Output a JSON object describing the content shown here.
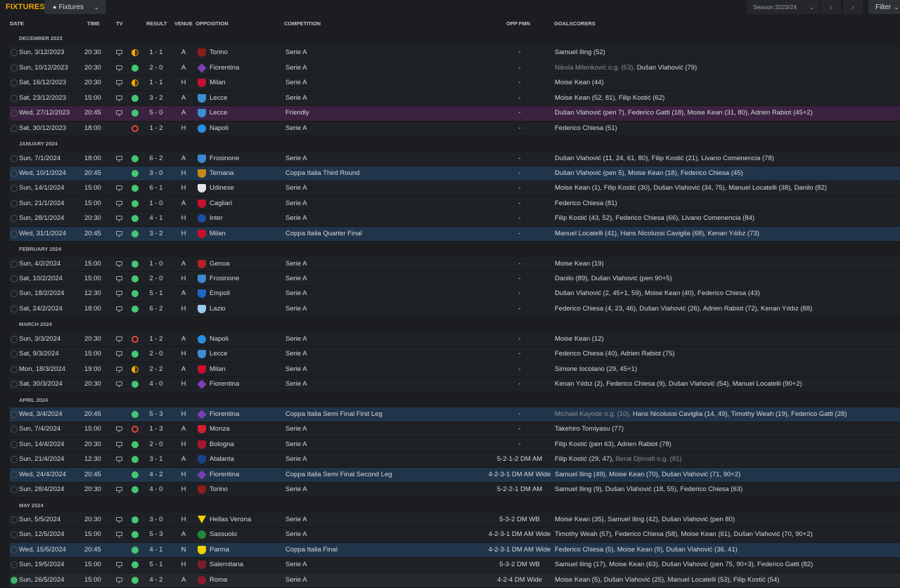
{
  "topbar": {
    "title": "FIXTURES",
    "view_label": "Fixtures",
    "season_label": "Season 2023/24",
    "filter_label": "Filter",
    "prev_icon": "chevron-left-icon",
    "next_icon": "chevron-right-icon"
  },
  "columns": {
    "date": "DATE",
    "time": "TIME",
    "tv": "TV",
    "result": "RESULT",
    "venue": "VENUE",
    "opposition": "OPPOSITION",
    "competition": "COMPETITION",
    "opp_fmn": "OPP FMN",
    "goalscorers": "GOALSCORERS"
  },
  "colors": {
    "accent": "#f2a900",
    "win": "#44c773",
    "loss": "#e2463b",
    "cup_row": "#21354a",
    "friendly_row": "#3b2240"
  },
  "months": [
    {
      "label": "DECEMBER 2023",
      "rows": [
        {
          "chk": "pending",
          "date": "Sun, 3/12/2023",
          "time": "20:30",
          "tv": true,
          "res": "D",
          "score": "1 - 1",
          "venue": "A",
          "opp": "Torino",
          "crest": "#8b1d1d",
          "shape": "shield",
          "comp": "Serie A",
          "fmn": "-",
          "gs": [
            {
              "t": "Samuel Iling (52)"
            }
          ],
          "hl": ""
        },
        {
          "chk": "pending",
          "date": "Sun, 10/12/2023",
          "time": "20:30",
          "tv": true,
          "res": "W",
          "score": "2 - 0",
          "venue": "A",
          "opp": "Fiorentina",
          "crest": "#7b3fb5",
          "shape": "diamond",
          "comp": "Serie A",
          "fmn": "-",
          "gs": [
            {
              "t": "Nikola Milenković o.g. (53), ",
              "g": true
            },
            {
              "t": "Dušan Vlahović (79)"
            }
          ],
          "hl": ""
        },
        {
          "chk": "pending",
          "date": "Sat, 16/12/2023",
          "time": "20:30",
          "tv": true,
          "res": "D",
          "score": "1 - 1",
          "venue": "H",
          "opp": "Milan",
          "crest": "#c8102e",
          "shape": "shield",
          "comp": "Serie A",
          "fmn": "-",
          "gs": [
            {
              "t": "Moise Kean (44)"
            }
          ],
          "hl": ""
        },
        {
          "chk": "pending",
          "date": "Sat, 23/12/2023",
          "time": "15:00",
          "tv": true,
          "res": "W",
          "score": "3 - 2",
          "venue": "A",
          "opp": "Lecce",
          "crest": "#3b8fd6",
          "shape": "shield",
          "comp": "Serie A",
          "fmn": "-",
          "gs": [
            {
              "t": "Moise Kean (52, 81), Filip Kostić (62)"
            }
          ],
          "hl": ""
        },
        {
          "chk": "pending",
          "date": "Wed, 27/12/2023",
          "time": "20:45",
          "tv": true,
          "res": "W",
          "score": "5 - 0",
          "venue": "A",
          "opp": "Lecce",
          "crest": "#3b8fd6",
          "shape": "shield",
          "comp": "Friendly",
          "fmn": "-",
          "gs": [
            {
              "t": "Dušan Vlahović (pen 7), Federico Gatti (18), Moise Kean (31, 80), Adrien Rabiot (45+2)"
            }
          ],
          "hl": "friendly"
        },
        {
          "chk": "pending",
          "date": "Sat, 30/12/2023",
          "time": "18:00",
          "tv": false,
          "res": "L",
          "score": "1 - 2",
          "venue": "H",
          "opp": "Napoli",
          "crest": "#2a8fe0",
          "shape": "circle",
          "comp": "Serie A",
          "fmn": "-",
          "gs": [
            {
              "t": "Federico Chiesa (51)"
            }
          ],
          "hl": ""
        }
      ]
    },
    {
      "label": "JANUARY 2024",
      "rows": [
        {
          "chk": "pending",
          "date": "Sun, 7/1/2024",
          "time": "18:00",
          "tv": true,
          "res": "W",
          "score": "6 - 2",
          "venue": "A",
          "opp": "Frosinone",
          "crest": "#3e8ad1",
          "shape": "shield",
          "comp": "Serie A",
          "fmn": "-",
          "gs": [
            {
              "t": "Dušan Vlahović (11, 24, 61, 80), Filip Kostić (21), Livano Comenencia (78)"
            }
          ],
          "hl": ""
        },
        {
          "chk": "pending",
          "date": "Wed, 10/1/2024",
          "time": "20:45",
          "tv": false,
          "res": "W",
          "score": "3 - 0",
          "venue": "H",
          "opp": "Ternana",
          "crest": "#c88a1e",
          "shape": "shield",
          "comp": "Coppa Italia Third Round",
          "fmn": "-",
          "gs": [
            {
              "t": "Dušan Vlahović (pen 5), Moise Kean (18), Federico Chiesa (45)"
            }
          ],
          "hl": "cup"
        },
        {
          "chk": "pending",
          "date": "Sun, 14/1/2024",
          "time": "15:00",
          "tv": true,
          "res": "W",
          "score": "6 - 1",
          "venue": "H",
          "opp": "Udinese",
          "crest": "#e6e6e6",
          "shape": "shield",
          "comp": "Serie A",
          "fmn": "-",
          "gs": [
            {
              "t": "Moise Kean (1), Filip Kostić (30), Dušan Vlahović (34, 75), Manuel Locatelli (38), Danilo (82)"
            }
          ],
          "hl": ""
        },
        {
          "chk": "pending",
          "date": "Sun, 21/1/2024",
          "time": "15:00",
          "tv": true,
          "res": "W",
          "score": "1 - 0",
          "venue": "A",
          "opp": "Cagliari",
          "crest": "#c8102e",
          "shape": "shield",
          "comp": "Serie A",
          "fmn": "-",
          "gs": [
            {
              "t": "Federico Chiesa (81)"
            }
          ],
          "hl": ""
        },
        {
          "chk": "pending",
          "date": "Sun, 28/1/2024",
          "time": "20:30",
          "tv": true,
          "res": "W",
          "score": "4 - 1",
          "venue": "H",
          "opp": "Inter",
          "crest": "#1b4fa3",
          "shape": "circle",
          "comp": "Serie A",
          "fmn": "-",
          "gs": [
            {
              "t": "Filip Kostić (43, 52), Federico Chiesa (66), Livano Comenencia (84)"
            }
          ],
          "hl": ""
        },
        {
          "chk": "pending",
          "date": "Wed, 31/1/2024",
          "time": "20:45",
          "tv": true,
          "res": "W",
          "score": "3 - 2",
          "venue": "H",
          "opp": "Milan",
          "crest": "#c8102e",
          "shape": "shield",
          "comp": "Coppa Italia Quarter Final",
          "fmn": "-",
          "gs": [
            {
              "t": "Manuel Locatelli (41), Hans Nicolussi Caviglia (68), Kenan Yıldız (73)"
            }
          ],
          "hl": "cup"
        }
      ]
    },
    {
      "label": "FEBRUARY 2024",
      "rows": [
        {
          "chk": "pending",
          "date": "Sun, 4/2/2024",
          "time": "15:00",
          "tv": true,
          "res": "W",
          "score": "1 - 0",
          "venue": "A",
          "opp": "Genoa",
          "crest": "#b22222",
          "shape": "shield",
          "comp": "Serie A",
          "fmn": "-",
          "gs": [
            {
              "t": "Moise Kean (19)"
            }
          ],
          "hl": ""
        },
        {
          "chk": "pending",
          "date": "Sat, 10/2/2024",
          "time": "15:00",
          "tv": true,
          "res": "W",
          "score": "2 - 0",
          "venue": "H",
          "opp": "Frosinone",
          "crest": "#3e8ad1",
          "shape": "shield",
          "comp": "Serie A",
          "fmn": "-",
          "gs": [
            {
              "t": "Danilo (89), Dušan Vlahović (pen 90+5)"
            }
          ],
          "hl": ""
        },
        {
          "chk": "pending",
          "date": "Sun, 18/2/2024",
          "time": "12:30",
          "tv": true,
          "res": "W",
          "score": "5 - 1",
          "venue": "A",
          "opp": "Empoli",
          "crest": "#2066c8",
          "shape": "shield",
          "comp": "Serie A",
          "fmn": "-",
          "gs": [
            {
              "t": "Dušan Vlahović (2, 45+1, 59), Moise Kean (40), Federico Chiesa (43)"
            }
          ],
          "hl": ""
        },
        {
          "chk": "pending",
          "date": "Sat, 24/2/2024",
          "time": "18:00",
          "tv": true,
          "res": "W",
          "score": "6 - 2",
          "venue": "H",
          "opp": "Lazio",
          "crest": "#9fc8ea",
          "shape": "shield",
          "comp": "Serie A",
          "fmn": "-",
          "gs": [
            {
              "t": "Federico Chiesa (4, 23, 46), Dušan Vlahović (26), Adrien Rabiot (72), Kenan Yıldız (88)"
            }
          ],
          "hl": ""
        }
      ]
    },
    {
      "label": "MARCH 2024",
      "rows": [
        {
          "chk": "pending",
          "date": "Sun, 3/3/2024",
          "time": "20:30",
          "tv": true,
          "res": "L",
          "score": "1 - 2",
          "venue": "A",
          "opp": "Napoli",
          "crest": "#2a8fe0",
          "shape": "circle",
          "comp": "Serie A",
          "fmn": "-",
          "gs": [
            {
              "t": "Moise Kean (12)"
            }
          ],
          "hl": ""
        },
        {
          "chk": "pending",
          "date": "Sat, 9/3/2024",
          "time": "15:00",
          "tv": true,
          "res": "W",
          "score": "2 - 0",
          "venue": "H",
          "opp": "Lecce",
          "crest": "#3b8fd6",
          "shape": "shield",
          "comp": "Serie A",
          "fmn": "-",
          "gs": [
            {
              "t": "Federico Chiesa (40), Adrien Rabiot (75)"
            }
          ],
          "hl": ""
        },
        {
          "chk": "pending",
          "date": "Mon, 18/3/2024",
          "time": "19:00",
          "tv": true,
          "res": "D",
          "score": "2 - 2",
          "venue": "A",
          "opp": "Milan",
          "crest": "#c8102e",
          "shape": "shield",
          "comp": "Serie A",
          "fmn": "-",
          "gs": [
            {
              "t": "Simone Iocolano (29, 45+1)"
            }
          ],
          "hl": ""
        },
        {
          "chk": "pending",
          "date": "Sat, 30/3/2024",
          "time": "20:30",
          "tv": true,
          "res": "W",
          "score": "4 - 0",
          "venue": "H",
          "opp": "Fiorentina",
          "crest": "#7b3fb5",
          "shape": "diamond",
          "comp": "Serie A",
          "fmn": "-",
          "gs": [
            {
              "t": "Kenan Yıldız (2), Federico Chiesa (9), Dušan Vlahović (54), Manuel Locatelli (90+2)"
            }
          ],
          "hl": ""
        }
      ]
    },
    {
      "label": "APRIL 2024",
      "rows": [
        {
          "chk": "pending",
          "date": "Wed, 3/4/2024",
          "time": "20:45",
          "tv": false,
          "res": "W",
          "score": "5 - 3",
          "venue": "H",
          "opp": "Fiorentina",
          "crest": "#7b3fb5",
          "shape": "diamond",
          "comp": "Coppa Italia Semi Final First Leg",
          "fmn": "-",
          "gs": [
            {
              "t": "Michael Kayode o.g. (10), ",
              "g": true
            },
            {
              "t": "Hans Nicolussi Caviglia (14, 49), Timothy Weah (19), Federico Gatti (28)"
            }
          ],
          "hl": "cup"
        },
        {
          "chk": "pending",
          "date": "Sun, 7/4/2024",
          "time": "15:00",
          "tv": true,
          "res": "L",
          "score": "1 - 3",
          "venue": "A",
          "opp": "Monza",
          "crest": "#d0202e",
          "shape": "shield",
          "comp": "Serie A",
          "fmn": "-",
          "gs": [
            {
              "t": "Takehiro Tomiyasu (77)"
            }
          ],
          "hl": ""
        },
        {
          "chk": "pending",
          "date": "Sun, 14/4/2024",
          "time": "20:30",
          "tv": true,
          "res": "W",
          "score": "2 - 0",
          "venue": "H",
          "opp": "Bologna",
          "crest": "#a8162e",
          "shape": "shield",
          "comp": "Serie A",
          "fmn": "-",
          "gs": [
            {
              "t": "Filip Kostić (pen 63), Adrien Rabiot (78)"
            }
          ],
          "hl": ""
        },
        {
          "chk": "pending",
          "date": "Sun, 21/4/2024",
          "time": "12:30",
          "tv": true,
          "res": "W",
          "score": "3 - 1",
          "venue": "A",
          "opp": "Atalanta",
          "crest": "#1d3f8a",
          "shape": "shield",
          "comp": "Serie A",
          "fmn": "5-2-1-2 DM AM",
          "gs": [
            {
              "t": "Filip Kostić (29, 47), "
            },
            {
              "t": "Berat Djimsiti o.g. (81)",
              "g": true
            }
          ],
          "hl": ""
        },
        {
          "chk": "pending",
          "date": "Wed, 24/4/2024",
          "time": "20:45",
          "tv": false,
          "res": "W",
          "score": "4 - 2",
          "venue": "H",
          "opp": "Fiorentina",
          "crest": "#7b3fb5",
          "shape": "diamond",
          "comp": "Coppa Italia Semi Final Second Leg",
          "fmn": "4-2-3-1 DM AM Wide",
          "gs": [
            {
              "t": "Samuel Iling (49), Moise Kean (70), Dušan Vlahović (71, 90+2)"
            }
          ],
          "hl": "cup"
        },
        {
          "chk": "pending",
          "date": "Sun, 28/4/2024",
          "time": "20:30",
          "tv": true,
          "res": "W",
          "score": "4 - 0",
          "venue": "H",
          "opp": "Torino",
          "crest": "#8b1d1d",
          "shape": "shield",
          "comp": "Serie A",
          "fmn": "5-2-2-1 DM AM",
          "gs": [
            {
              "t": "Samuel Iling (9), Dušan Vlahović (18, 55), Federico Chiesa (63)"
            }
          ],
          "hl": ""
        }
      ]
    },
    {
      "label": "MAY 2024",
      "rows": [
        {
          "chk": "pending",
          "date": "Sun, 5/5/2024",
          "time": "20:30",
          "tv": true,
          "res": "W",
          "score": "3 - 0",
          "venue": "H",
          "opp": "Hellas Verona",
          "crest": "#f2d000",
          "shape": "tri",
          "comp": "Serie A",
          "fmn": "5-3-2 DM WB",
          "gs": [
            {
              "t": "Moise Kean (35), Samuel Iling (42), Dušan Vlahović (pen 80)"
            }
          ],
          "hl": ""
        },
        {
          "chk": "pending",
          "date": "Sun, 12/5/2024",
          "time": "15:00",
          "tv": true,
          "res": "W",
          "score": "5 - 3",
          "venue": "A",
          "opp": "Sassuolo",
          "crest": "#1e8a3c",
          "shape": "circle",
          "comp": "Serie A",
          "fmn": "4-2-3-1 DM AM Wide",
          "gs": [
            {
              "t": "Timothy Weah (57), Federico Chiesa (58), Moise Kean (61), Dušan Vlahović (70, 90+2)"
            }
          ],
          "hl": ""
        },
        {
          "chk": "pending",
          "date": "Wed, 15/5/2024",
          "time": "20:45",
          "tv": false,
          "res": "W",
          "score": "4 - 1",
          "venue": "N",
          "opp": "Parma",
          "crest": "#f2d000",
          "shape": "shield",
          "comp": "Coppa Italia Final",
          "fmn": "4-2-3-1 DM AM Wide",
          "gs": [
            {
              "t": "Federico Chiesa (5), Moise Kean (9), Dušan Vlahović (36, 41)"
            }
          ],
          "hl": "cup"
        },
        {
          "chk": "pending",
          "date": "Sun, 19/5/2024",
          "time": "15:00",
          "tv": true,
          "res": "W",
          "score": "5 - 1",
          "venue": "H",
          "opp": "Salernitana",
          "crest": "#7a1f2b",
          "shape": "shield",
          "comp": "Serie A",
          "fmn": "5-3-2 DM WB",
          "gs": [
            {
              "t": "Samuel Iling (17), Moise Kean (63), Dušan Vlahović (pen 75, 90+3), Federico Gatti (82)"
            }
          ],
          "hl": ""
        },
        {
          "chk": "done",
          "date": "Sun, 26/5/2024",
          "time": "15:00",
          "tv": true,
          "res": "W",
          "score": "4 - 2",
          "venue": "A",
          "opp": "Roma",
          "crest": "#8e1b2b",
          "shape": "circle",
          "comp": "Serie A",
          "fmn": "4-2-4 DM Wide",
          "gs": [
            {
              "t": "Moise Kean (5), Dušan Vlahović (25), Manuel Locatelli (53), Filip Kostić (54)"
            }
          ],
          "hl": "last"
        }
      ]
    }
  ]
}
